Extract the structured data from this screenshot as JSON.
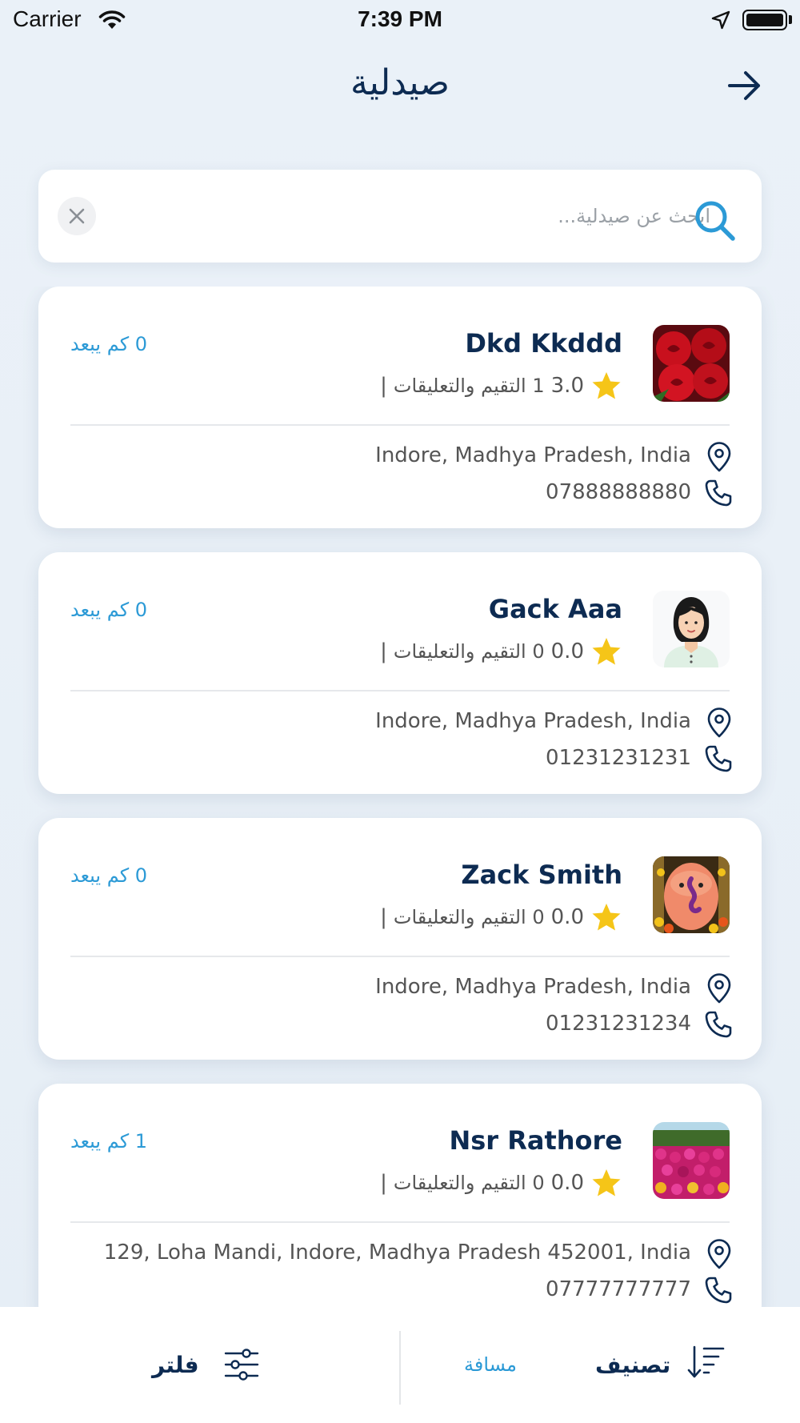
{
  "status_bar": {
    "carrier": "Carrier",
    "time": "7:39 PM"
  },
  "nav": {
    "title": "صيدلية"
  },
  "search": {
    "placeholder": "ابحث عن صيدلية...",
    "value": ""
  },
  "pharmacies": [
    {
      "name": "Dkd Kkddd",
      "rating": "3.0",
      "reviews_label": "1 التقيم والتعليقات",
      "distance": "0 كم يبعد",
      "address": "Indore, Madhya Pradesh, India",
      "phone": "07888888880",
      "thumb": "red-roses"
    },
    {
      "name": "Gack Aaa",
      "rating": "0.0",
      "reviews_label": "0 التقيم والتعليقات",
      "distance": "0 كم يبعد",
      "address": "Indore, Madhya Pradesh, India",
      "phone": "01231231231",
      "thumb": "woman-avatar"
    },
    {
      "name": "Zack Smith",
      "rating": "0.0",
      "reviews_label": "0 التقيم والتعليقات",
      "distance": "0 كم يبعد",
      "address": "Indore, Madhya Pradesh, India",
      "phone": "01231231234",
      "thumb": "ganesha-idol"
    },
    {
      "name": "Nsr Rathore",
      "rating": "0.0",
      "reviews_label": "0 التقيم والتعليقات",
      "distance": "1 كم يبعد",
      "address": "129, Loha Mandi, Indore, Madhya Pradesh 452001, India",
      "phone": "07777777777",
      "thumb": "flower-garden"
    }
  ],
  "bottom_bar": {
    "filter_label": "فلتر",
    "distance_label": "مسافة",
    "sort_label": "تصنيف"
  },
  "colors": {
    "accent": "#2c9ad6",
    "title": "#0d2b52",
    "star": "#f5c518"
  }
}
